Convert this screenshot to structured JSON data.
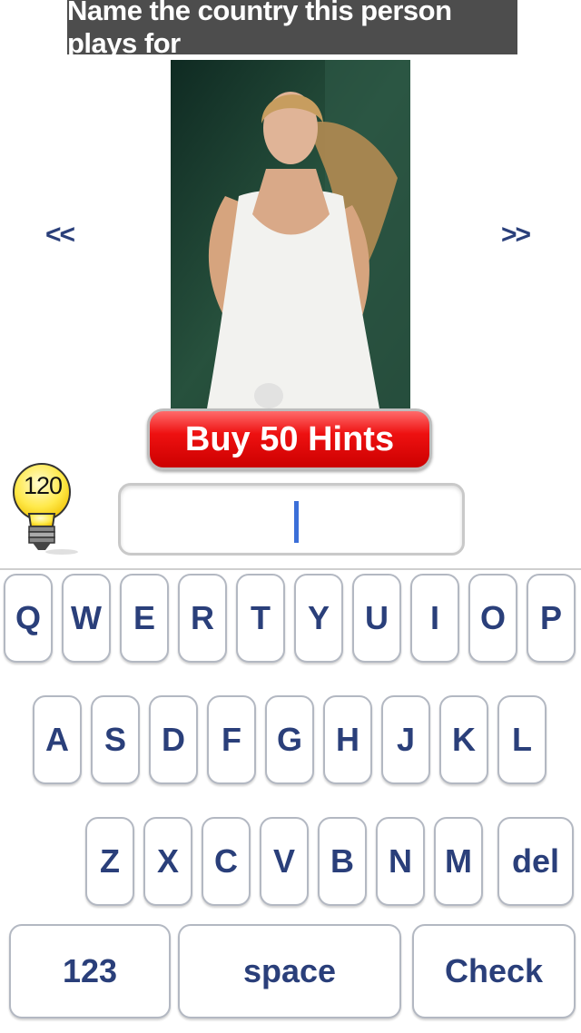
{
  "header": {
    "question": "Name the country this person plays for"
  },
  "nav": {
    "prev": "<<",
    "next": ">>"
  },
  "hints": {
    "buy_label": "Buy 50 Hints",
    "count": "120"
  },
  "answer": {
    "value": ""
  },
  "keyboard": {
    "row1": [
      "Q",
      "W",
      "E",
      "R",
      "T",
      "Y",
      "U",
      "I",
      "O",
      "P"
    ],
    "row2": [
      "A",
      "S",
      "D",
      "F",
      "G",
      "H",
      "J",
      "K",
      "L"
    ],
    "row3": [
      "Z",
      "X",
      "C",
      "V",
      "B",
      "N",
      "M"
    ],
    "del": "del",
    "numbers": "123",
    "space": "space",
    "check": "Check"
  },
  "colors": {
    "key_text": "#2a3f7a",
    "buy_button": "#ee1111",
    "title_bg": "#4d4d4d"
  }
}
